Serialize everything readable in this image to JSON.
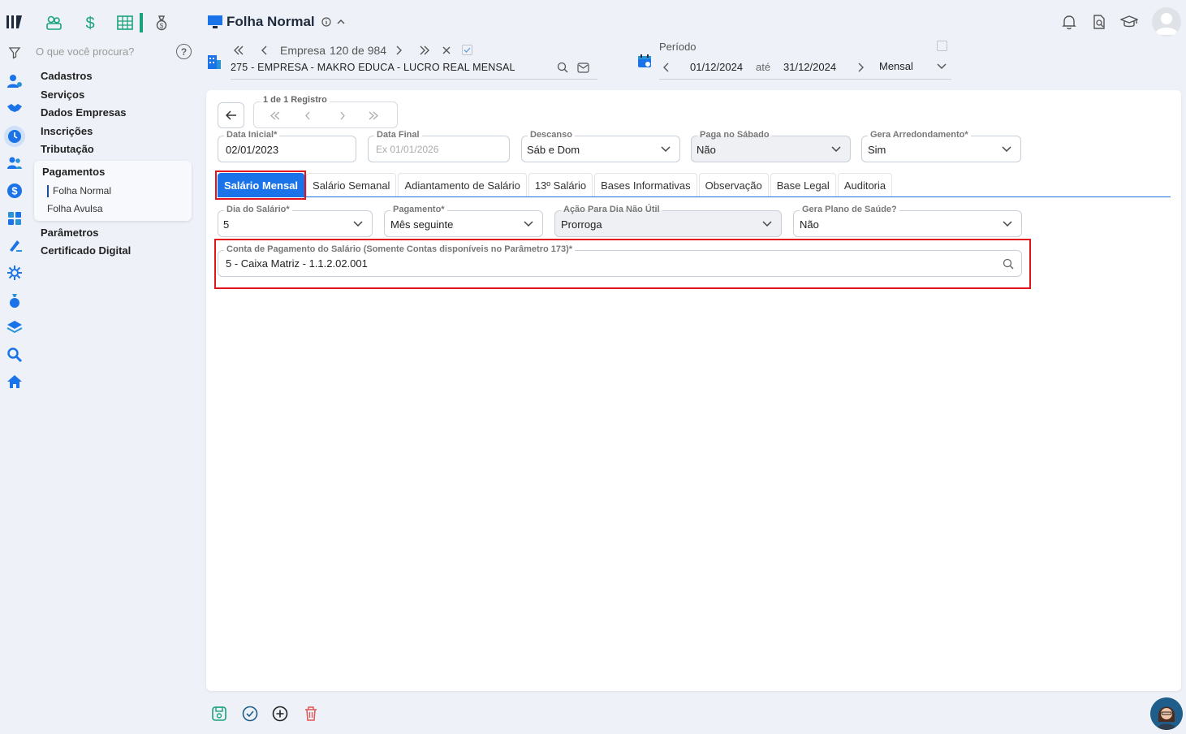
{
  "header": {
    "title": "Folha Normal",
    "company_counter_prefix": "Empresa",
    "company_counter": "120 de 984",
    "company_name": "275 - EMPRESA - MAKRO EDUCA - LUCRO REAL MENSAL",
    "period_label": "Período",
    "date_start": "01/12/2024",
    "date_sep": "até",
    "date_end": "31/12/2024",
    "period_type": "Mensal"
  },
  "sidebar": {
    "search_placeholder": "O que você procura?",
    "help": "?",
    "items": [
      {
        "label": "Cadastros"
      },
      {
        "label": "Serviços"
      },
      {
        "label": "Dados Empresas"
      },
      {
        "label": "Inscrições"
      },
      {
        "label": "Tributação"
      },
      {
        "label": "Pagamentos"
      },
      {
        "label": "Parâmetros"
      },
      {
        "label": "Certificado Digital"
      }
    ],
    "submenu": [
      {
        "label": "Folha Normal",
        "active": true
      },
      {
        "label": "Folha Avulsa",
        "active": false
      }
    ]
  },
  "record_nav": {
    "label": "1 de 1 Registro"
  },
  "form": {
    "data_inicial": {
      "label": "Data Inicial*",
      "value": "02/01/2023"
    },
    "data_final": {
      "label": "Data Final",
      "placeholder": "Ex 01/01/2026"
    },
    "descanso": {
      "label": "Descanso",
      "value": "Sáb e Dom"
    },
    "paga_sabado": {
      "label": "Paga no Sábado",
      "value": "Não"
    },
    "gera_arredondamento": {
      "label": "Gera Arredondamento*",
      "value": "Sim"
    }
  },
  "tabs": [
    {
      "label": "Salário Mensal",
      "active": true
    },
    {
      "label": "Salário Semanal"
    },
    {
      "label": "Adiantamento de Salário"
    },
    {
      "label": "13º Salário"
    },
    {
      "label": "Bases Informativas"
    },
    {
      "label": "Observação"
    },
    {
      "label": "Base Legal"
    },
    {
      "label": "Auditoria"
    }
  ],
  "tab_content": {
    "dia_salario": {
      "label": "Dia do Salário*",
      "value": "5"
    },
    "pagamento": {
      "label": "Pagamento*",
      "value": "Mês seguinte"
    },
    "acao_dia_nao_util": {
      "label": "Ação Para Dia Não Útil",
      "value": "Prorroga"
    },
    "gera_plano_saude": {
      "label": "Gera Plano de Saúde?",
      "value": "Não"
    },
    "conta_pagamento": {
      "label": "Conta de Pagamento do Salário (Somente Contas disponíveis no Parâmetro 173)*",
      "value": "5 - Caixa Matriz  - 1.1.2.02.001"
    }
  },
  "colors": {
    "accent": "#1a73e8",
    "highlight": "#e0141a",
    "brand_green": "#1aa37a"
  }
}
